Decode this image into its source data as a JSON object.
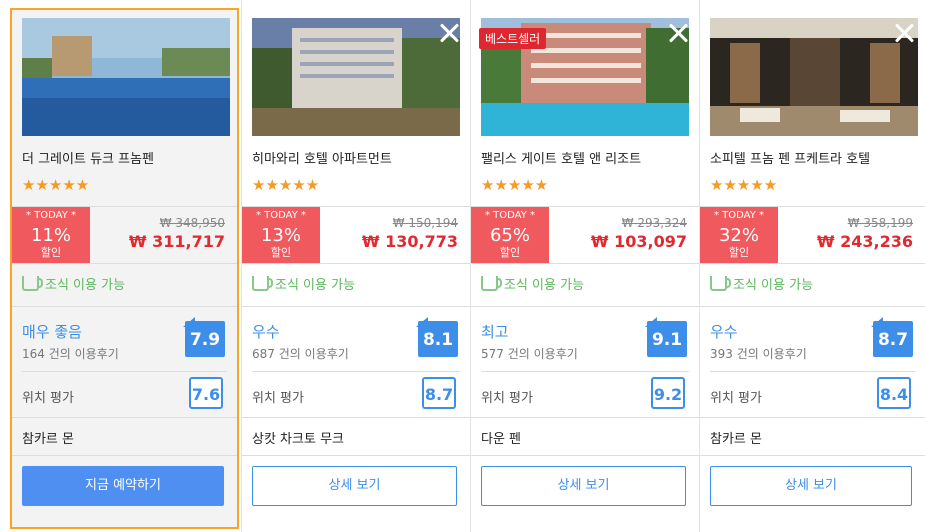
{
  "hotels": [
    {
      "name": "더 그레이트 듀크 프놈펜",
      "stars": "★★★★★",
      "deal_today": "* TODAY *",
      "deal_percent": "11%",
      "deal_off": "할인",
      "old_price": "₩ 348,950",
      "new_price": "₩ 311,717",
      "breakfast": "조식 이용 가능",
      "rating_word": "매우 좋음",
      "review_count": "164 건의 이용후기",
      "score": "7.9",
      "location_label": "위치 평가",
      "location_score": "7.6",
      "area": "참카르 몬",
      "button": "지금 예약하기",
      "badge": "",
      "selected": true
    },
    {
      "name": "히마와리 호텔 아파트먼트",
      "stars": "★★★★★",
      "deal_today": "* TODAY *",
      "deal_percent": "13%",
      "deal_off": "할인",
      "old_price": "₩ 150,194",
      "new_price": "₩ 130,773",
      "breakfast": "조식 이용 가능",
      "rating_word": "우수",
      "review_count": "687 건의 이용후기",
      "score": "8.1",
      "location_label": "위치 평가",
      "location_score": "8.7",
      "area": "상캇 차크토 무크",
      "button": "상세 보기",
      "badge": "",
      "selected": false
    },
    {
      "name": "팰리스 게이트 호텔 앤 리조트",
      "stars": "★★★★★",
      "deal_today": "* TODAY *",
      "deal_percent": "65%",
      "deal_off": "할인",
      "old_price": "₩ 293,324",
      "new_price": "₩ 103,097",
      "breakfast": "조식 이용 가능",
      "rating_word": "최고",
      "review_count": "577 건의 이용후기",
      "score": "9.1",
      "location_label": "위치 평가",
      "location_score": "9.2",
      "area": "다운 펜",
      "button": "상세 보기",
      "badge": "베스트셀러",
      "selected": false
    },
    {
      "name": "소피텔 프놈 펜 프케트라 호텔",
      "stars": "★★★★★",
      "deal_today": "* TODAY *",
      "deal_percent": "32%",
      "deal_off": "할인",
      "old_price": "₩ 358,199",
      "new_price": "₩ 243,236",
      "breakfast": "조식 이용 가능",
      "rating_word": "우수",
      "review_count": "393 건의 이용후기",
      "score": "8.7",
      "location_label": "위치 평가",
      "location_score": "8.4",
      "area": "참카르 몬",
      "button": "상세 보기",
      "badge": "",
      "selected": false
    }
  ],
  "colors": {
    "accent": "#3d8ee8",
    "deal": "#f05a5f",
    "price": "#e02a2f",
    "star": "#f59a23",
    "selected_border": "#f5a623",
    "breakfast": "#5cb85c"
  }
}
